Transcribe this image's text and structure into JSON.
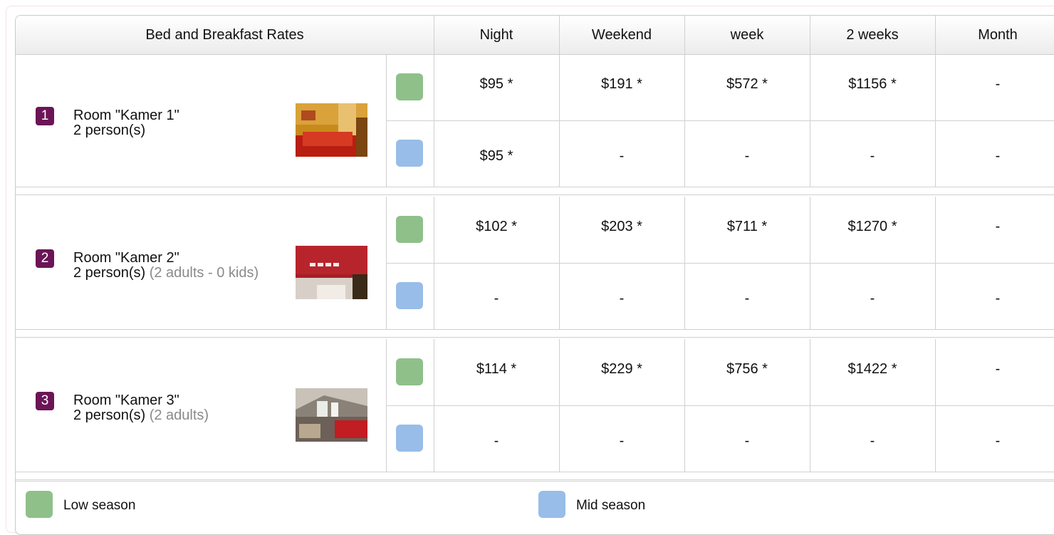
{
  "header": {
    "title": "Bed and Breakfast Rates",
    "columns": [
      "Night",
      "Weekend",
      "week",
      "2 weeks",
      "Month"
    ]
  },
  "seasons": {
    "low": {
      "label": "Low season",
      "color": "#8fc08a"
    },
    "mid": {
      "label": "Mid season",
      "color": "#98bde8"
    }
  },
  "rooms": [
    {
      "number": "1",
      "name": "Room \"Kamer 1\"",
      "persons": "2 person(s)",
      "detail": "",
      "photo": "bedroom-photo-yellow-walls",
      "low": [
        "$95 *",
        "$191 *",
        "$572 *",
        "$1156 *",
        "-"
      ],
      "mid": [
        "$95 *",
        "-",
        "-",
        "-",
        "-"
      ]
    },
    {
      "number": "2",
      "name": "Room \"Kamer 2\"",
      "persons": "2 person(s)",
      "detail": "(2 adults - 0 kids)",
      "photo": "bedroom-photo-red-wall",
      "low": [
        "$102 *",
        "$203 *",
        "$711 *",
        "$1270 *",
        "-"
      ],
      "mid": [
        "-",
        "-",
        "-",
        "-",
        "-"
      ]
    },
    {
      "number": "3",
      "name": "Room \"Kamer 3\"",
      "persons": "2 person(s)",
      "detail": "(2 adults)",
      "photo": "bedroom-photo-attic",
      "low": [
        "$114 *",
        "$229 *",
        "$756 *",
        "$1422 *",
        "-"
      ],
      "mid": [
        "-",
        "-",
        "-",
        "-",
        "-"
      ]
    }
  ],
  "legend": [
    {
      "label": "Low season",
      "color": "#8fc08a"
    },
    {
      "label": "Mid season",
      "color": "#98bde8"
    }
  ]
}
